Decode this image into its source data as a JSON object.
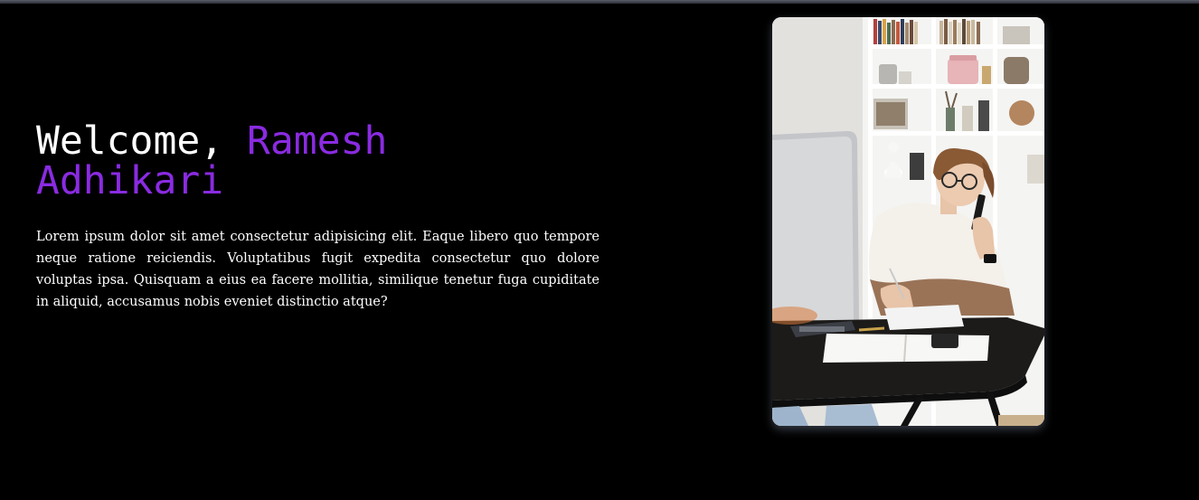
{
  "hero": {
    "greeting": "Welcome, ",
    "name_line1": "Ramesh",
    "name_line2": "Adhikari",
    "description": "Lorem ipsum dolor sit amet consectetur adipisicing elit. Eaque libero quo tempore neque ratione reiciendis. Voluptatibus fugit expedita consectetur quo dolore voluptas ipsa. Quisquam a eius ea facere mollitia, similique tenetur fuga cupiditate in aliquid, accusamus nobis eveniet distinctio atque?"
  },
  "photo": {
    "subject": "woman-working-at-desk"
  },
  "colors": {
    "background": "#000000",
    "accent": "#8a2be2",
    "text": "#ffffff"
  }
}
